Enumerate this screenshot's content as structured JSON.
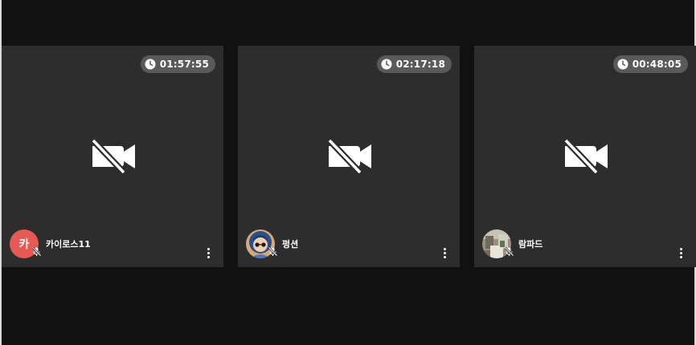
{
  "participants": [
    {
      "timer": "01:57:55",
      "name": "카이로스11",
      "avatar": {
        "type": "letter",
        "letter": "카",
        "color": "#e65a55"
      },
      "camera_icon": "video-off-icon",
      "mic_icon": "mic-off-icon"
    },
    {
      "timer": "02:17:18",
      "name": "펑션",
      "avatar": {
        "type": "image"
      },
      "camera_icon": "video-off-icon",
      "mic_icon": "mic-off-icon"
    },
    {
      "timer": "00:48:05",
      "name": "람파드",
      "avatar": {
        "type": "image"
      },
      "camera_icon": "video-off-icon",
      "mic_icon": "mic-off-icon"
    }
  ],
  "colors": {
    "background": "#111111",
    "tile": "#2d2d2d",
    "timer_pill": "#5a5a5a",
    "text": "#ffffff"
  }
}
